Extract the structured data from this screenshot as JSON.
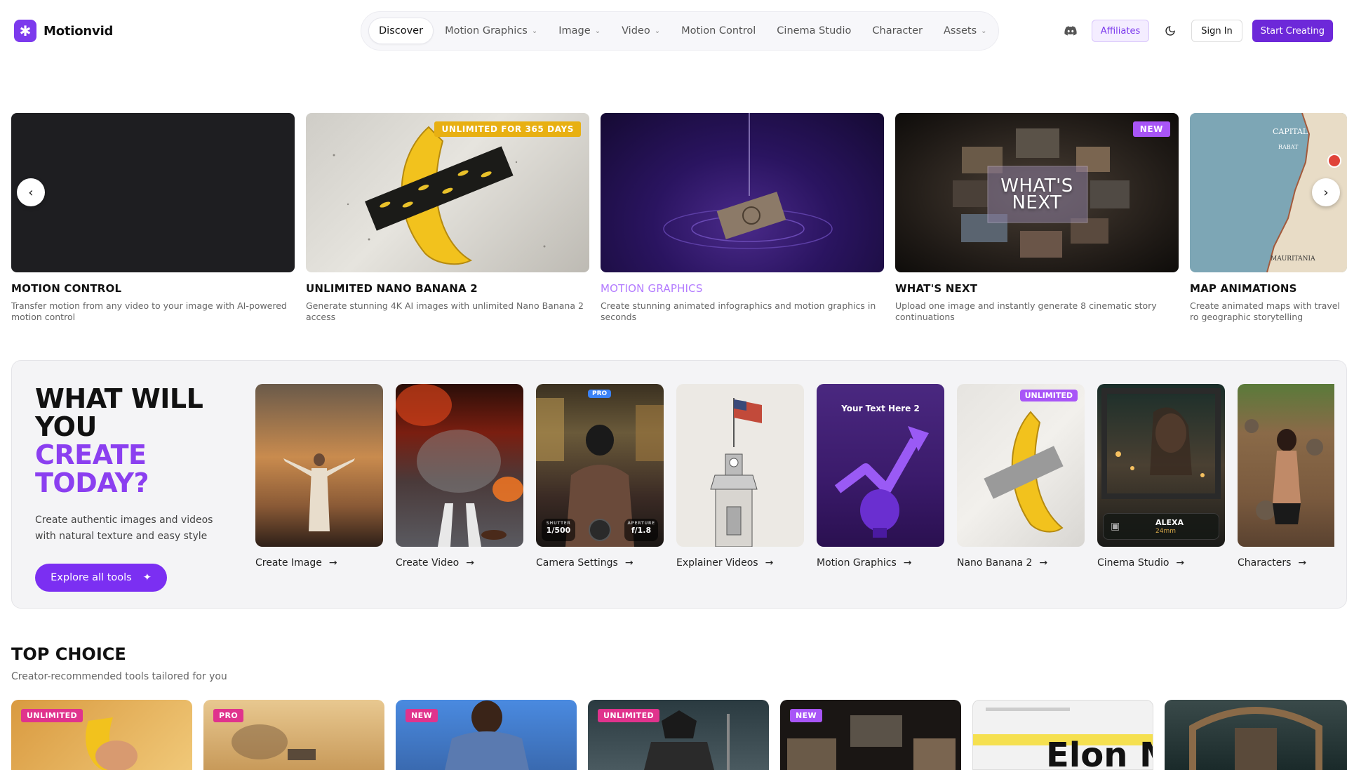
{
  "brand": {
    "name": "Motionvid",
    "logo_icon": "asterisk-icon"
  },
  "nav": {
    "items": [
      {
        "label": "Discover",
        "active": true,
        "dropdown": false
      },
      {
        "label": "Motion Graphics",
        "dropdown": true
      },
      {
        "label": "Image",
        "dropdown": true
      },
      {
        "label": "Video",
        "dropdown": true
      },
      {
        "label": "Motion Control",
        "dropdown": false
      },
      {
        "label": "Cinema Studio",
        "dropdown": false
      },
      {
        "label": "Character",
        "dropdown": false
      },
      {
        "label": "Assets",
        "dropdown": true
      }
    ],
    "discord_icon": "discord-icon",
    "affiliates": "Affiliates",
    "theme_icon": "moon-icon",
    "sign_in": "Sign In",
    "start_creating": "Start Creating"
  },
  "hero": {
    "slides": [
      {
        "title": "MOTION CONTROL",
        "desc": "Transfer motion from any video to your image with AI-powered motion control",
        "badge": ""
      },
      {
        "title": "UNLIMITED NANO BANANA 2",
        "desc": "Generate stunning 4K AI images with unlimited Nano Banana 2 access",
        "badge": "UNLIMITED FOR 365 DAYS"
      },
      {
        "title": "MOTION GRAPHICS",
        "desc": "Create stunning animated infographics and motion graphics in seconds",
        "badge": ""
      },
      {
        "title": "WHAT'S NEXT",
        "desc": "Upload one image and instantly generate 8 cinematic story continuations",
        "badge": "NEW",
        "overlay": "WHAT'S NEXT"
      },
      {
        "title": "MAP ANIMATIONS",
        "desc": "Create animated maps with travel ro geographic storytelling",
        "badge": "",
        "map_labels": [
          "CAPITAL",
          "RABAT",
          "MAURITANIA"
        ]
      }
    ],
    "prev_icon": "chevron-left-icon",
    "next_icon": "chevron-right-icon"
  },
  "create": {
    "heading_line1": "WHAT WILL",
    "heading_line2": "YOU",
    "heading_line3": "CREATE",
    "heading_line4": "TODAY?",
    "subtitle": "Create authentic images and videos with natural texture and easy style",
    "explore_label": "Explore all tools",
    "explore_icon": "sparkle-icon",
    "tools": [
      {
        "label": "Create Image",
        "badge": ""
      },
      {
        "label": "Create Video",
        "badge": ""
      },
      {
        "label": "Camera Settings",
        "badge": "PRO",
        "shutter_label": "SHUTTER",
        "shutter": "1/500",
        "aperture_label": "APERTURE",
        "aperture": "f/1.8"
      },
      {
        "label": "Explainer Videos",
        "badge": ""
      },
      {
        "label": "Motion Graphics",
        "badge": "",
        "overlay": "Your Text Here 2"
      },
      {
        "label": "Nano Banana 2",
        "badge": "UNLIMITED"
      },
      {
        "label": "Cinema Studio",
        "badge": "",
        "camera": "ALEXA",
        "lens": "24mm"
      },
      {
        "label": "Characters",
        "badge": ""
      }
    ],
    "arrow_icon": "arrow-right-icon"
  },
  "top_choice": {
    "title": "TOP CHOICE",
    "subtitle": "Creator-recommended tools tailored for you",
    "cards": [
      {
        "badge": "UNLIMITED"
      },
      {
        "badge": "PRO"
      },
      {
        "badge": "NEW"
      },
      {
        "badge": "UNLIMITED"
      },
      {
        "badge": "NEW"
      },
      {
        "badge": "",
        "text": "Elon M"
      },
      {
        "badge": ""
      }
    ]
  },
  "colors": {
    "accent": "#6d28d9",
    "badge_pink": "#e0338d",
    "badge_gold": "#e8b012",
    "badge_purple": "#a855f7"
  }
}
